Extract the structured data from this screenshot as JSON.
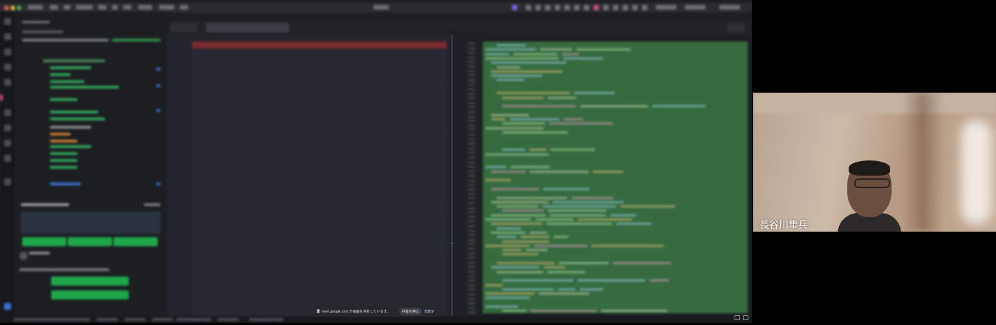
{
  "shared_screen": {
    "share_notice": {
      "message": "meet.google.com が画面を共有しています。",
      "stop_button": "共有を停止",
      "hide_button": "非表示"
    }
  },
  "video_tile": {
    "participant_name": "長谷川隼兵"
  },
  "colors": {
    "code_background": "#356b3f",
    "editor_background": "#1d1f23",
    "green_button": "#1fa64a"
  },
  "icons": [
    "share-icon",
    "pin-icon",
    "expand-icon"
  ]
}
